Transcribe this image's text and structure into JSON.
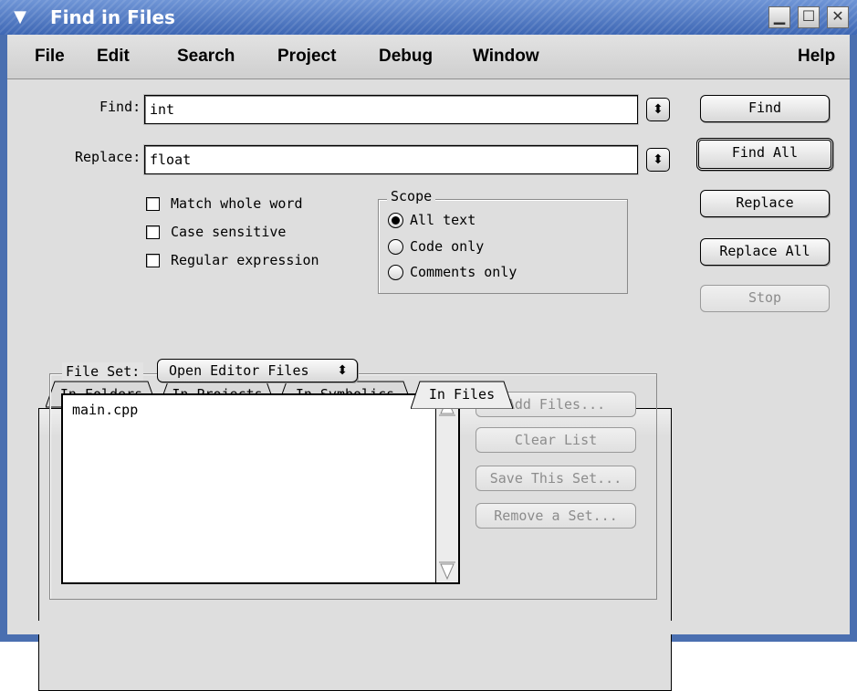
{
  "window": {
    "title": "Find in Files",
    "controls": [
      "minimize",
      "maximize",
      "close"
    ]
  },
  "menu": {
    "items": [
      "File",
      "Edit",
      "Search",
      "Project",
      "Debug",
      "Window",
      "Help"
    ]
  },
  "find": {
    "find_label": "Find:",
    "find_value": "int",
    "replace_label": "Replace:",
    "replace_value": "float"
  },
  "options": {
    "match_whole_word": {
      "label": "Match whole word",
      "checked": false
    },
    "case_sensitive": {
      "label": "Case sensitive",
      "checked": false
    },
    "regular_expression": {
      "label": "Regular expression",
      "checked": false
    }
  },
  "scope": {
    "title": "Scope",
    "options": [
      "All text",
      "Code only",
      "Comments only"
    ],
    "selected": "All text"
  },
  "actions": {
    "find": "Find",
    "find_all": "Find All",
    "replace": "Replace",
    "replace_all": "Replace All",
    "stop": "Stop"
  },
  "tabs": {
    "items": [
      "In Folders",
      "In Projects",
      "In Symbolics",
      "In Files"
    ],
    "active": "In Files"
  },
  "file_set": {
    "label": "File Set:",
    "selected": "Open Editor Files",
    "files": [
      "main.cpp"
    ]
  },
  "file_actions": {
    "add_files": "Add Files...",
    "clear_list": "Clear List",
    "save_this_set": "Save This Set...",
    "remove_a_set": "Remove a Set..."
  }
}
